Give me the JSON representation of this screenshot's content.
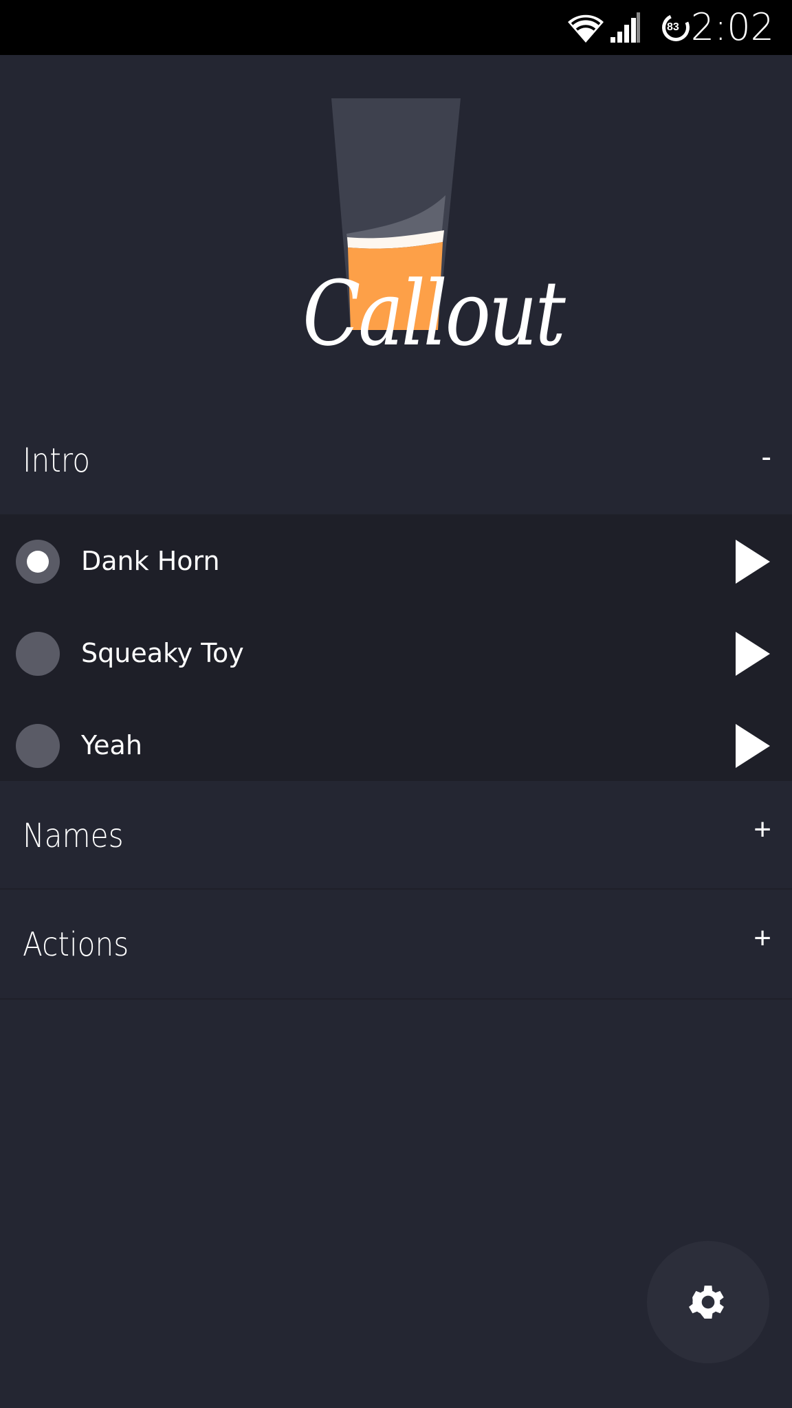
{
  "status_bar": {
    "time": "2:02",
    "battery_level": "83",
    "icons": [
      "wifi-icon",
      "signal-icon",
      "battery-icon"
    ]
  },
  "logo": {
    "text": "Callout",
    "accent": "#fda048"
  },
  "sections": [
    {
      "title": "Intro",
      "toggle": "-",
      "expanded": true,
      "items": [
        {
          "label": "Dank Horn",
          "selected": true
        },
        {
          "label": "Squeaky Toy",
          "selected": false
        },
        {
          "label": "Yeah",
          "selected": false
        }
      ]
    },
    {
      "title": "Names",
      "toggle": "+",
      "expanded": false
    },
    {
      "title": "Actions",
      "toggle": "+",
      "expanded": false
    }
  ],
  "fab": {
    "icon": "gear-icon"
  }
}
